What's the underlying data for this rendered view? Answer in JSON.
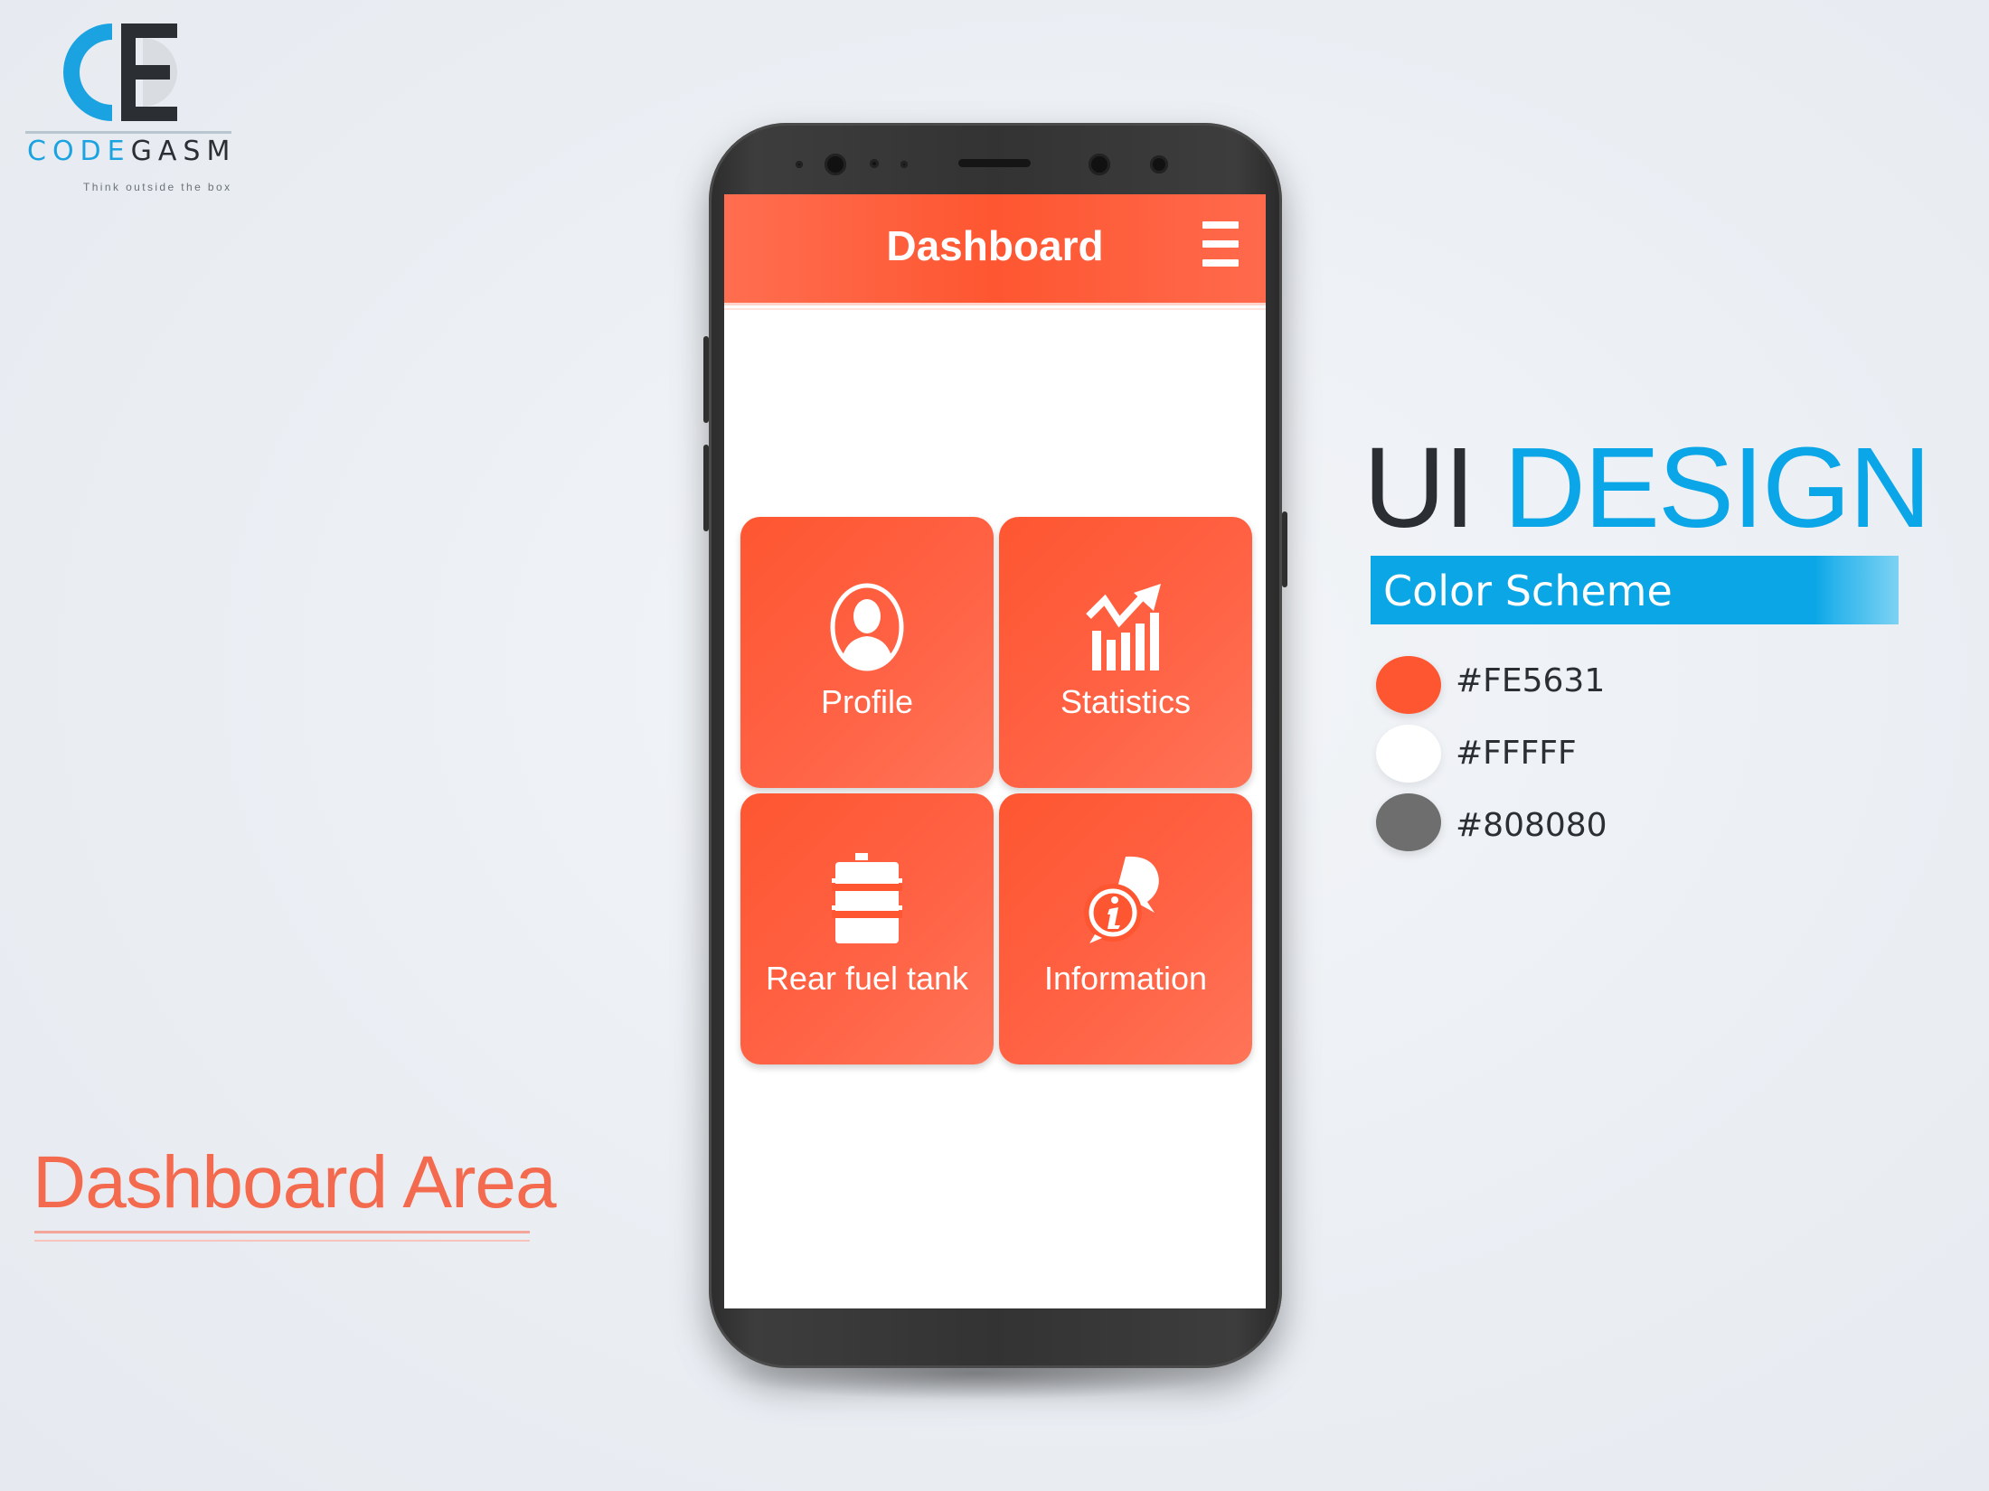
{
  "brand": {
    "wordmark": "CODEGASM",
    "wordmark_accent": "CODE",
    "wordmark_rest": "GASM",
    "tagline": "Think outside the box",
    "logo_icon": "ce-monogram-icon"
  },
  "caption": {
    "title": "Dashboard Area"
  },
  "app": {
    "title": "Dashboard",
    "menu_icon": "hamburger-menu-icon",
    "tiles": [
      {
        "label": "Profile",
        "icon": "user-icon"
      },
      {
        "label": "Statistics",
        "icon": "bar-chart-trend-icon"
      },
      {
        "label": "Rear fuel tank",
        "icon": "fuel-barrel-icon"
      },
      {
        "label": "Information",
        "icon": "info-chat-icon"
      }
    ]
  },
  "design_panel": {
    "title_light": "UI",
    "title_bold": "DESIGN",
    "subtitle": "Color Scheme",
    "swatches": [
      {
        "label": "#FE5631",
        "color": "#fe5631"
      },
      {
        "label": "#FFFFF",
        "color": "#ffffff"
      },
      {
        "label": "#808080",
        "color": "#6e6e6e"
      }
    ]
  },
  "colors": {
    "primary": "#fe5631",
    "accent_blue": "#0aa6e6",
    "background": "#eef2f6",
    "phone_body": "#333333"
  }
}
